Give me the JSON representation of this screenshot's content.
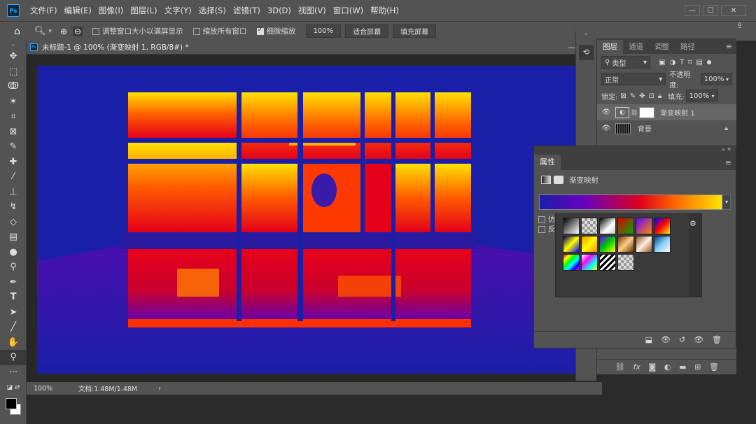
{
  "app": {
    "logo": "Ps"
  },
  "menu": [
    "文件(F)",
    "编辑(E)",
    "图像(I)",
    "图层(L)",
    "文字(Y)",
    "选择(S)",
    "滤镜(T)",
    "3D(D)",
    "视图(V)",
    "窗口(W)",
    "帮助(H)"
  ],
  "window_controls": {
    "minimize": "—",
    "restore": "☐",
    "close": "✕"
  },
  "options": {
    "resize_windows": "调整窗口大小以满屏显示",
    "zoom_all": "缩放所有窗口",
    "scrubby_zoom": "细微缩放",
    "zoom_value": "100%",
    "fit_screen": "适合屏幕",
    "fill_screen": "填充屏幕"
  },
  "document": {
    "title": "未标题-1 @ 100% (渐变映射 1, RGB/8#) *",
    "status_zoom": "100%",
    "status_doc": "文档:1.48M/1.48M",
    "arrow": "›"
  },
  "layers_panel": {
    "tabs": [
      "图层",
      "通道",
      "调整",
      "路径"
    ],
    "filter_label": "类型",
    "blend_mode": "正常",
    "opacity_label": "不透明度:",
    "opacity_value": "100%",
    "lock_label": "锁定:",
    "fill_label": "填充:",
    "fill_value": "100%",
    "layers": [
      {
        "name": "渐变映射 1",
        "active": true
      },
      {
        "name": "背景",
        "active": false
      }
    ]
  },
  "properties_panel": {
    "tab": "属性",
    "subtitle": "渐变映射",
    "option1": "仿",
    "option2": "反"
  },
  "colors": {
    "bg_panel": "#535353",
    "canvas_blue": "#1a1fa8",
    "accent": "#31a8ff"
  }
}
